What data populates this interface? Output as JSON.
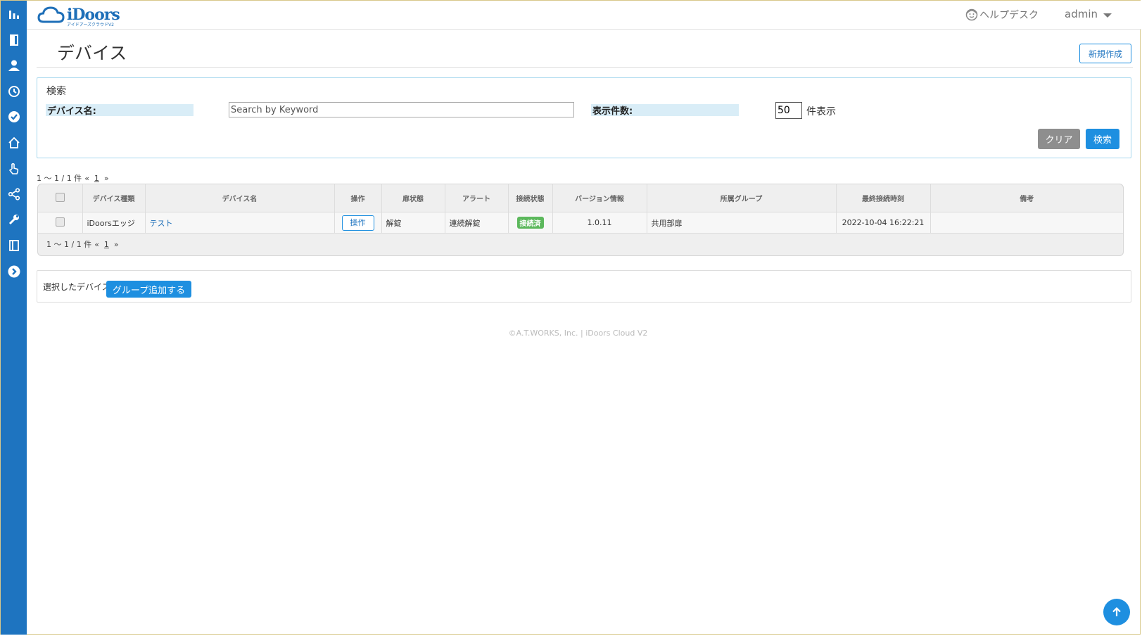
{
  "header": {
    "logo_text": "iDoors",
    "logo_sub": "アイドアーズクラウドV2",
    "help_label": "ヘルプデスク",
    "user_label": "admin"
  },
  "sidebar": {
    "icons": [
      "dashboard-icon",
      "door-icon",
      "user-icon",
      "clock-icon",
      "check-circle-icon",
      "home-icon",
      "hand-pointer-icon",
      "share-icon",
      "wrench-icon",
      "book-icon",
      "chevron-right-circle-icon"
    ]
  },
  "page": {
    "title": "デバイス",
    "new_button": "新規作成"
  },
  "search": {
    "heading": "検索",
    "device_name_label": "デバイス名:",
    "keyword_placeholder": "Search by Keyword",
    "count_label": "表示件数:",
    "count_value": "50",
    "count_suffix": "件表示",
    "clear_button": "クリア",
    "search_button": "検索"
  },
  "pagination": {
    "summary": "1 ～ 1 / 1 件",
    "prev": "«",
    "page": "1",
    "next": "»"
  },
  "table": {
    "columns": [
      "デバイス種類",
      "デバイス名",
      "操作",
      "扉状態",
      "アラート",
      "接続状態",
      "バージョン情報",
      "所属グループ",
      "最終接続時刻",
      "備考"
    ],
    "rows": [
      {
        "device_type": "iDoorsエッジ",
        "device_name": "テスト",
        "operation": "操作",
        "door_state": "解錠",
        "alert": "連続解錠",
        "connection": "接続済",
        "version": "1.0.11",
        "group": "共用部扉",
        "last_connected": "2022-10-04 16:22:21",
        "note": ""
      }
    ]
  },
  "group_action": {
    "label": "選択したデバイスへ",
    "button": "グループ追加する"
  },
  "footer": "©A.T.WORKS, Inc. | iDoors Cloud V2",
  "colors": {
    "sidebar": "#1e74c0",
    "primary": "#1e8fe0",
    "success": "#5cb85c",
    "label_bg": "#d9edf7"
  }
}
